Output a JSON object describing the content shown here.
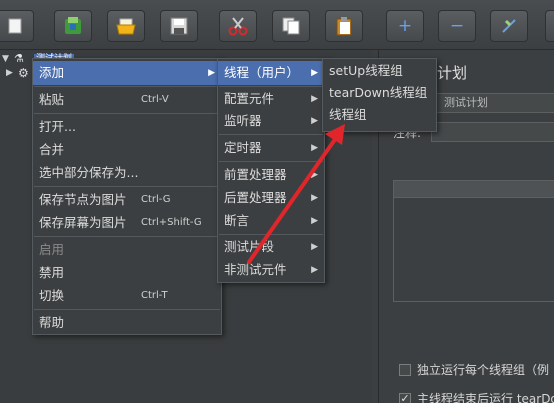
{
  "toolbar": {
    "buttons": [
      {
        "name": "new-icon"
      },
      {
        "name": "templates-icon"
      },
      {
        "name": "open-icon"
      },
      {
        "name": "save-icon"
      },
      {
        "name": "cut-icon"
      },
      {
        "name": "copy-icon"
      },
      {
        "name": "paste-icon"
      },
      {
        "name": "expand-icon",
        "glyph": "+"
      },
      {
        "name": "collapse-icon",
        "glyph": "−"
      },
      {
        "name": "toggle-icon"
      }
    ]
  },
  "tree": {
    "root_label": "测试计划"
  },
  "context_menu": {
    "items": [
      {
        "label": "添加",
        "submenu": true,
        "selected": true
      },
      {
        "label": "粘贴",
        "accel": "Ctrl-V"
      },
      {
        "label": "打开..."
      },
      {
        "label": "合并"
      },
      {
        "label": "选中部分保存为..."
      },
      {
        "label": "保存节点为图片",
        "accel": "Ctrl-G"
      },
      {
        "label": "保存屏幕为图片",
        "accel": "Ctrl+Shift-G"
      },
      {
        "label": "启用",
        "disabled": true
      },
      {
        "label": "禁用"
      },
      {
        "label": "切换",
        "accel": "Ctrl-T"
      },
      {
        "label": "帮助"
      }
    ]
  },
  "add_submenu": {
    "items": [
      {
        "label": "线程（用户）",
        "selected": true
      },
      {
        "label": "配置元件"
      },
      {
        "label": "监听器"
      },
      {
        "label": "定时器"
      },
      {
        "label": "前置处理器"
      },
      {
        "label": "后置处理器"
      },
      {
        "label": "断言"
      },
      {
        "label": "测试片段"
      },
      {
        "label": "非测试元件"
      }
    ]
  },
  "threads_submenu": {
    "items": [
      {
        "label": "setUp线程组"
      },
      {
        "label": "tearDown线程组"
      },
      {
        "label": "线程组"
      }
    ]
  },
  "right_panel": {
    "title_partial": "计划",
    "name_value": "测试计划",
    "comment_label": "注释:",
    "checkbox1_label": "独立运行每个线程组（例",
    "checkbox2_label": "主线程结束后运行 tearDo"
  },
  "annotation": {
    "color": "#e0262a"
  }
}
